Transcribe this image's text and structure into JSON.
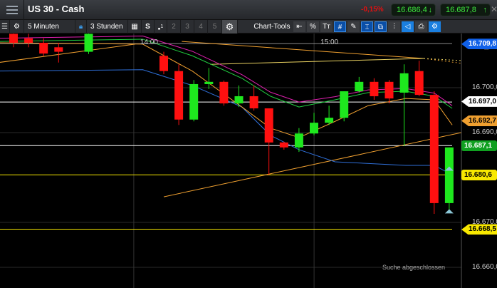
{
  "header": {
    "title": "US 30 - Cash",
    "change": "-0,15%",
    "bid": "16.686,4",
    "ask": "16.687,8",
    "bid_icon": "arrow-down-icon",
    "ask_icon": "arrow-up-icon"
  },
  "toolbar": {
    "interval": "5 Minuten",
    "range": "3 Stunden",
    "s_label": "S",
    "layout_sup": "1",
    "layouts": [
      "2",
      "3",
      "4",
      "5"
    ],
    "chart_tools": "Chart-Tools",
    "tools": [
      {
        "icon": "back-icon",
        "glyph": "⇤"
      },
      {
        "icon": "percent-icon",
        "glyph": "%"
      },
      {
        "icon": "text-icon",
        "glyph": "Tт"
      },
      {
        "icon": "grid-icon",
        "glyph": "#",
        "on": true
      },
      {
        "icon": "draw-grid-icon",
        "glyph": "✎"
      },
      {
        "icon": "candle-icon",
        "glyph": "⌶",
        "on": true
      },
      {
        "icon": "compare-icon",
        "glyph": "⧉",
        "on": true
      },
      {
        "icon": "indicator-icon",
        "glyph": "⫶"
      },
      {
        "icon": "label-icon",
        "glyph": "◁",
        "bright": true
      },
      {
        "icon": "print-icon",
        "glyph": "⎙"
      },
      {
        "icon": "settings-icon",
        "glyph": "⚙",
        "bright": true
      }
    ]
  },
  "colors": {
    "up": "#1ee81e",
    "down": "#ff1010",
    "blue_ma": "#2f6fd8",
    "orange": "#f0a030",
    "green_ma": "#20d040",
    "magenta_ma": "#e020b0",
    "hline_white": "#ffffff",
    "hline_yellow": "#f0e000"
  },
  "chart_data": {
    "type": "candlestick",
    "time_labels": [
      {
        "label": "14:00",
        "i": 9
      },
      {
        "label": "15:00",
        "i": 21
      }
    ],
    "y_ticks": [
      {
        "label": "16.700,0",
        "v": 16700
      },
      {
        "label": "16.690,0",
        "v": 16690
      },
      {
        "label": "16.670,0",
        "v": 16670
      },
      {
        "label": "16.660,0",
        "v": 16660
      }
    ],
    "candles": [
      {
        "i": 0,
        "o": 16712,
        "c": 16710,
        "h": 16713,
        "l": 16709
      },
      {
        "i": 1,
        "o": 16711,
        "c": 16710,
        "h": 16712,
        "l": 16709
      },
      {
        "i": 2,
        "o": 16710,
        "c": 16707.6,
        "h": 16711,
        "l": 16707
      },
      {
        "i": 3,
        "o": 16709,
        "c": 16708,
        "h": 16710,
        "l": 16705.6
      },
      {
        "i": 5,
        "o": 16708,
        "c": 16712,
        "h": 16713,
        "l": 16707.5
      },
      {
        "i": 10,
        "o": 16707.1,
        "c": 16703.7,
        "h": 16708,
        "l": 16703
      },
      {
        "i": 11,
        "o": 16703.7,
        "c": 16692.9,
        "h": 16705.2,
        "l": 16691.7
      },
      {
        "i": 12,
        "o": 16692.9,
        "c": 16700.8,
        "h": 16701.7,
        "l": 16692.5
      },
      {
        "i": 13,
        "o": 16700.8,
        "c": 16701.3,
        "h": 16704.4,
        "l": 16699.7
      },
      {
        "i": 14,
        "o": 16701.3,
        "c": 16696.5,
        "h": 16701.6,
        "l": 16696
      },
      {
        "i": 15,
        "o": 16696.5,
        "c": 16698.1,
        "h": 16700.5,
        "l": 16695.7
      },
      {
        "i": 16,
        "o": 16698.1,
        "c": 16695.4,
        "h": 16700.5,
        "l": 16694.9
      },
      {
        "i": 17,
        "o": 16695.4,
        "c": 16687.8,
        "h": 16695.4,
        "l": 16680.6
      },
      {
        "i": 18,
        "o": 16687.8,
        "c": 16686.7,
        "h": 16688,
        "l": 16686.2
      },
      {
        "i": 19,
        "o": 16686.7,
        "c": 16689.8,
        "h": 16691,
        "l": 16685.7
      },
      {
        "i": 20,
        "o": 16689.8,
        "c": 16692.2,
        "h": 16694.4,
        "l": 16689.4
      },
      {
        "i": 21,
        "o": 16692.2,
        "c": 16693.3,
        "h": 16696,
        "l": 16691.7
      },
      {
        "i": 22,
        "o": 16693.3,
        "c": 16699.2,
        "h": 16699.2,
        "l": 16692.5
      },
      {
        "i": 23,
        "o": 16699.2,
        "c": 16701.3,
        "h": 16702.4,
        "l": 16698.9
      },
      {
        "i": 24,
        "o": 16701.3,
        "c": 16698.1,
        "h": 16702.1,
        "l": 16697.3
      },
      {
        "i": 25,
        "o": 16701.3,
        "c": 16697.6,
        "h": 16701.7,
        "l": 16696.5
      },
      {
        "i": 26,
        "o": 16698.9,
        "c": 16703.2,
        "h": 16705.2,
        "l": 16687
      },
      {
        "i": 27,
        "o": 16703.7,
        "c": 16698.4,
        "h": 16706,
        "l": 16698.1
      },
      {
        "i": 28,
        "o": 16698.4,
        "c": 16674.3,
        "h": 16699.2,
        "l": 16671.9
      },
      {
        "i": 29,
        "o": 16674.3,
        "c": 16686.7,
        "h": 16686.7,
        "l": 16672.7
      }
    ],
    "moving_averages": [
      {
        "color": "#2f6fd8",
        "points": [
          [
            -1,
            16703.7
          ],
          [
            8.6,
            16704
          ],
          [
            11.9,
            16700.5
          ],
          [
            15.2,
            16695.7
          ],
          [
            17.1,
            16689.4
          ],
          [
            19,
            16686.2
          ],
          [
            21.4,
            16683.5
          ],
          [
            26.1,
            16682.7
          ],
          [
            28,
            16682.7
          ],
          [
            29.2,
            16680.6
          ]
        ]
      },
      {
        "color": "#f0a030",
        "points": [
          [
            -1,
            16710
          ],
          [
            8.6,
            16709.7
          ],
          [
            11.9,
            16703.7
          ],
          [
            15.2,
            16695.7
          ],
          [
            17.1,
            16691
          ],
          [
            19,
            16688.9
          ],
          [
            21.4,
            16692.5
          ],
          [
            23.6,
            16696
          ],
          [
            26.1,
            16697.6
          ],
          [
            28,
            16697.3
          ],
          [
            29.2,
            16691.7
          ]
        ]
      },
      {
        "color": "#e020b0",
        "points": [
          [
            -1,
            16711
          ],
          [
            8.6,
            16711.5
          ],
          [
            11.9,
            16708.1
          ],
          [
            15.2,
            16702.9
          ],
          [
            17.1,
            16699
          ],
          [
            19,
            16696.8
          ],
          [
            21.4,
            16698
          ],
          [
            23.6,
            16699.5
          ],
          [
            26.1,
            16699.8
          ],
          [
            28,
            16698.8
          ],
          [
            29.2,
            16696
          ]
        ]
      },
      {
        "color": "#20d040",
        "points": [
          [
            -1,
            16710.3
          ],
          [
            8.6,
            16710.8
          ],
          [
            11.9,
            16707.1
          ],
          [
            15.2,
            16702.1
          ],
          [
            17.1,
            16698.1
          ],
          [
            19,
            16695.7
          ],
          [
            21.4,
            16697.3
          ],
          [
            23.6,
            16698.9
          ],
          [
            26.1,
            16699.2
          ],
          [
            28,
            16698.1
          ],
          [
            29.2,
            16695.4
          ]
        ]
      }
    ],
    "trend_lines": [
      {
        "color": "#f0a030",
        "from": [
          10,
          16675.7
        ],
        "to": [
          29.8,
          16690
        ],
        "dotted_to": [
          32.5,
          16692
        ]
      },
      {
        "color": "#f0a030",
        "from": [
          -1,
          16705.6
        ],
        "to": [
          8.1,
          16709.7
        ]
      },
      {
        "color": "#f0a030",
        "from": [
          11.2,
          16710.3
        ],
        "to": [
          27.3,
          16706.5
        ],
        "dotted_to": [
          32.5,
          16704.3
        ]
      },
      {
        "color": "#e8d060",
        "from": [
          13.1,
          16705.2
        ],
        "to": [
          27.3,
          16706.5
        ],
        "dotted_to": [
          30,
          16706
        ]
      }
    ],
    "horizontal_lines": [
      {
        "v": 16709.8,
        "color": "#888888"
      },
      {
        "v": 16696.8,
        "color": "#ffffff"
      },
      {
        "v": 16687.1,
        "color": "#ffffff"
      },
      {
        "v": 16680.6,
        "color": "#f0e000"
      },
      {
        "v": 16668.5,
        "color": "#f0e000"
      }
    ],
    "price_tags": [
      {
        "label": "16.709,8",
        "v": 16709.8,
        "bg": "#1060e8",
        "fg": "#ffffff"
      },
      {
        "label": "16.697,0",
        "v": 16697.0,
        "bg": "#ffffff",
        "fg": "#000000"
      },
      {
        "label": "16.692,7",
        "v": 16692.7,
        "bg": "#f0a030",
        "fg": "#000000"
      },
      {
        "label": "16.687,1",
        "v": 16687.1,
        "bg": "#10a020",
        "fg": "#ffffff",
        "box": true
      },
      {
        "label": "16.680,6",
        "v": 16680.6,
        "bg": "#f8e800",
        "fg": "#000000",
        "box": true
      },
      {
        "label": "16.668,5",
        "v": 16668.5,
        "bg": "#f8e800",
        "fg": "#000000"
      }
    ]
  },
  "status": "Suche abgeschlossen"
}
